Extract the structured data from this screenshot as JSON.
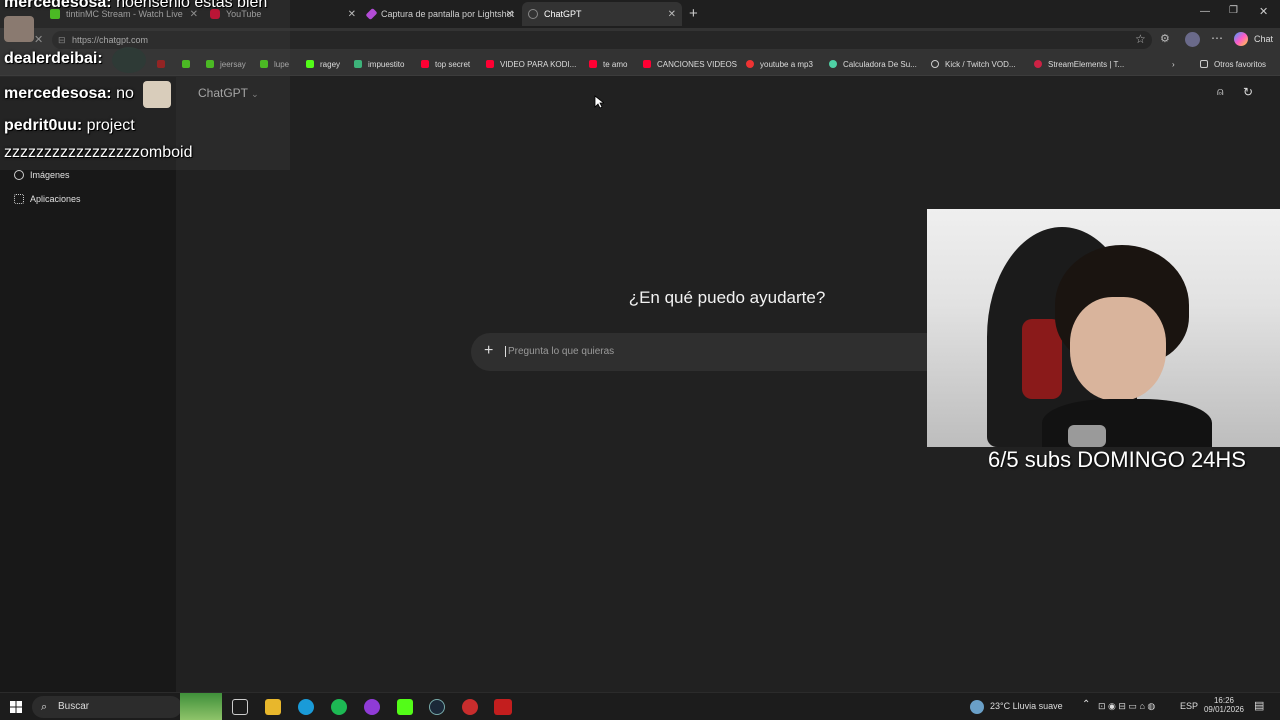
{
  "browser": {
    "tabs": [
      {
        "label": "tintinMC Stream - Watch Live",
        "active": false
      },
      {
        "label": "YouTube",
        "active": false
      },
      {
        "label": "Captura de pantalla por Lightshot",
        "active": false
      },
      {
        "label": "ChatGPT",
        "active": true
      }
    ],
    "url": "https://chatgpt.com",
    "bookmarks": [
      "jeersay",
      "lupe",
      "ragey",
      "impuestito",
      "top secret",
      "VIDEO PARA KODI...",
      "te amo",
      "CANCIONES VIDEOS",
      "youtube a mp3",
      "Calculadora De Su...",
      "Kick / Twitch VOD...",
      "StreamElements | T...",
      "Otros favoritos"
    ],
    "chat_label": "Chat"
  },
  "sidebar": {
    "items": [
      {
        "label": "Imágenes"
      },
      {
        "label": "Aplicaciones"
      }
    ]
  },
  "main": {
    "model": "ChatGPT",
    "hero": "¿En qué puedo ayudarte?",
    "prompt_placeholder": "Pregunta lo que quieras"
  },
  "stream_overlay": {
    "chat": [
      {
        "user": "mercedesosa:",
        "msg": "noensenio estas bien"
      },
      {
        "user": "dealerdeibai:",
        "msg": ""
      },
      {
        "user": "mercedesosa:",
        "msg": "no"
      },
      {
        "user": "pedrit0uu:",
        "msg": "project"
      },
      {
        "user": "",
        "msg": "zzzzzzzzzzzzzzzzzomboid"
      }
    ],
    "sub_goal": "6/5 subs DOMINGO 24HS"
  },
  "taskbar": {
    "search": "Buscar",
    "weather": "23°C  Lluvia suave",
    "lang": "ESP",
    "time": "16:26",
    "date": "09/01/2026"
  },
  "colors": {
    "chatgpt_bg": "#212121",
    "sidebar_bg": "#181818",
    "kick_green": "#53fc18"
  }
}
